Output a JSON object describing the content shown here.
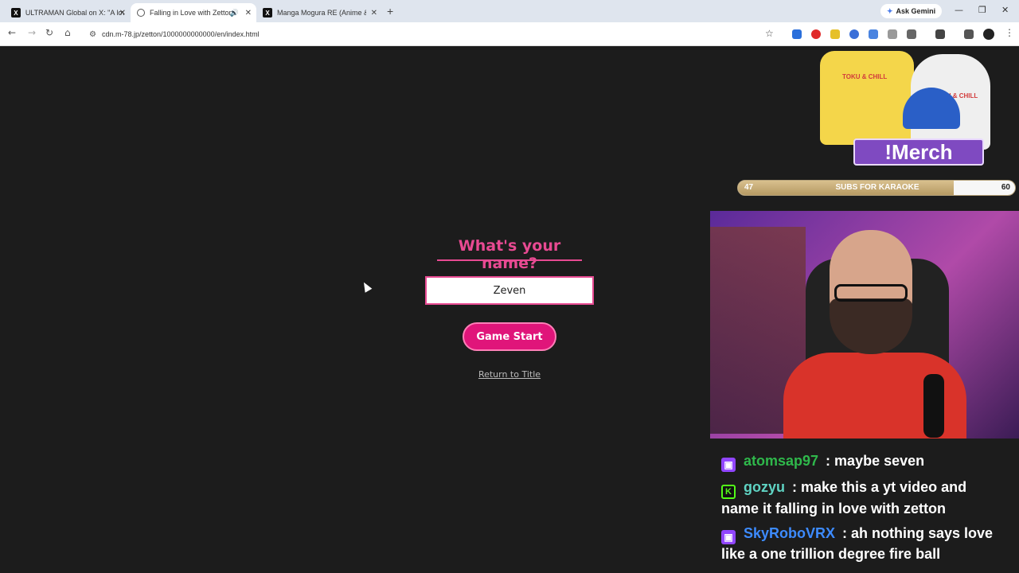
{
  "browser": {
    "tabs": [
      {
        "title": "ULTRAMAN Global on X: \"A lov",
        "icon": "x-icon",
        "active": false
      },
      {
        "title": "Falling in Love with Zetton",
        "icon": "globe-icon",
        "active": true
      },
      {
        "title": "Manga Mogura RE (Anime & M",
        "icon": "x-icon",
        "active": false
      }
    ],
    "new_tab": "+",
    "ask_gemini": "Ask Gemini",
    "url": "cdn.m-78.jp/zetton/1000000000000/en/index.html"
  },
  "page": {
    "heading": "What's your name?",
    "name_value": "Zeven",
    "start_button": "Game Start",
    "return_link": "Return to Title",
    "accent_color": "#e0157a"
  },
  "overlay": {
    "merch_label": "!Merch",
    "merch_shirt_text": "TOKU & CHILL",
    "subs_goal": {
      "current": "47",
      "label": "SUBS FOR KARAOKE",
      "target": "60",
      "progress": 0.78
    },
    "chat": [
      {
        "platform": "twitch",
        "user": "atomsap97",
        "user_color": "#2fb84b",
        "message": "maybe seven"
      },
      {
        "platform": "kick",
        "user": "gozyu",
        "user_color": "#5fd3c3",
        "message": "make this a yt video and name it falling in love with zetton"
      },
      {
        "platform": "twitch",
        "user": "SkyRoboVRX",
        "user_color": "#3d8bff",
        "message": "ah nothing says love like a one trillion degree fire ball"
      }
    ]
  }
}
